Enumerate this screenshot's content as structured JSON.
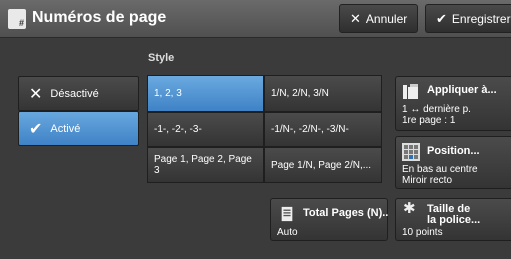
{
  "header": {
    "title": "Numéros de page",
    "cancel_label": "Annuler",
    "save_label": "Enregistrer"
  },
  "style": {
    "label": "Style",
    "options": [
      "1, 2, 3",
      "1/N, 2/N, 3/N",
      "-1-, -2-, -3-",
      "-1/N-, -2/N-, -3/N-",
      "Page 1, Page 2, Page 3",
      "Page 1/N, Page 2/N,..."
    ],
    "selected": "1, 2, 3"
  },
  "toggle": {
    "off_label": "Désactivé",
    "on_label": "Activé",
    "selected": "Activé"
  },
  "apply": {
    "title": "Appliquer à...",
    "value_line1": "1 ↔ dernière p.",
    "value_line2": "1re page : 1"
  },
  "position": {
    "title": "Position...",
    "value_line1": "En bas au centre",
    "value_line2": "Miroir recto"
  },
  "total_pages": {
    "title": "Total Pages (N)..",
    "value": "Auto"
  },
  "font_size": {
    "title_line1": "Taille de",
    "title_line2": "la police...",
    "value": "10 points"
  },
  "icons": {
    "title": "page-number-icon",
    "cancel": "x-icon",
    "save": "check-icon",
    "apply": "pages-stack-icon",
    "position": "grid-position-icon",
    "total": "document-icon",
    "font": "gear-icon"
  },
  "colors": {
    "selected": "#4a8fd0",
    "background": "#3b3b3b"
  }
}
